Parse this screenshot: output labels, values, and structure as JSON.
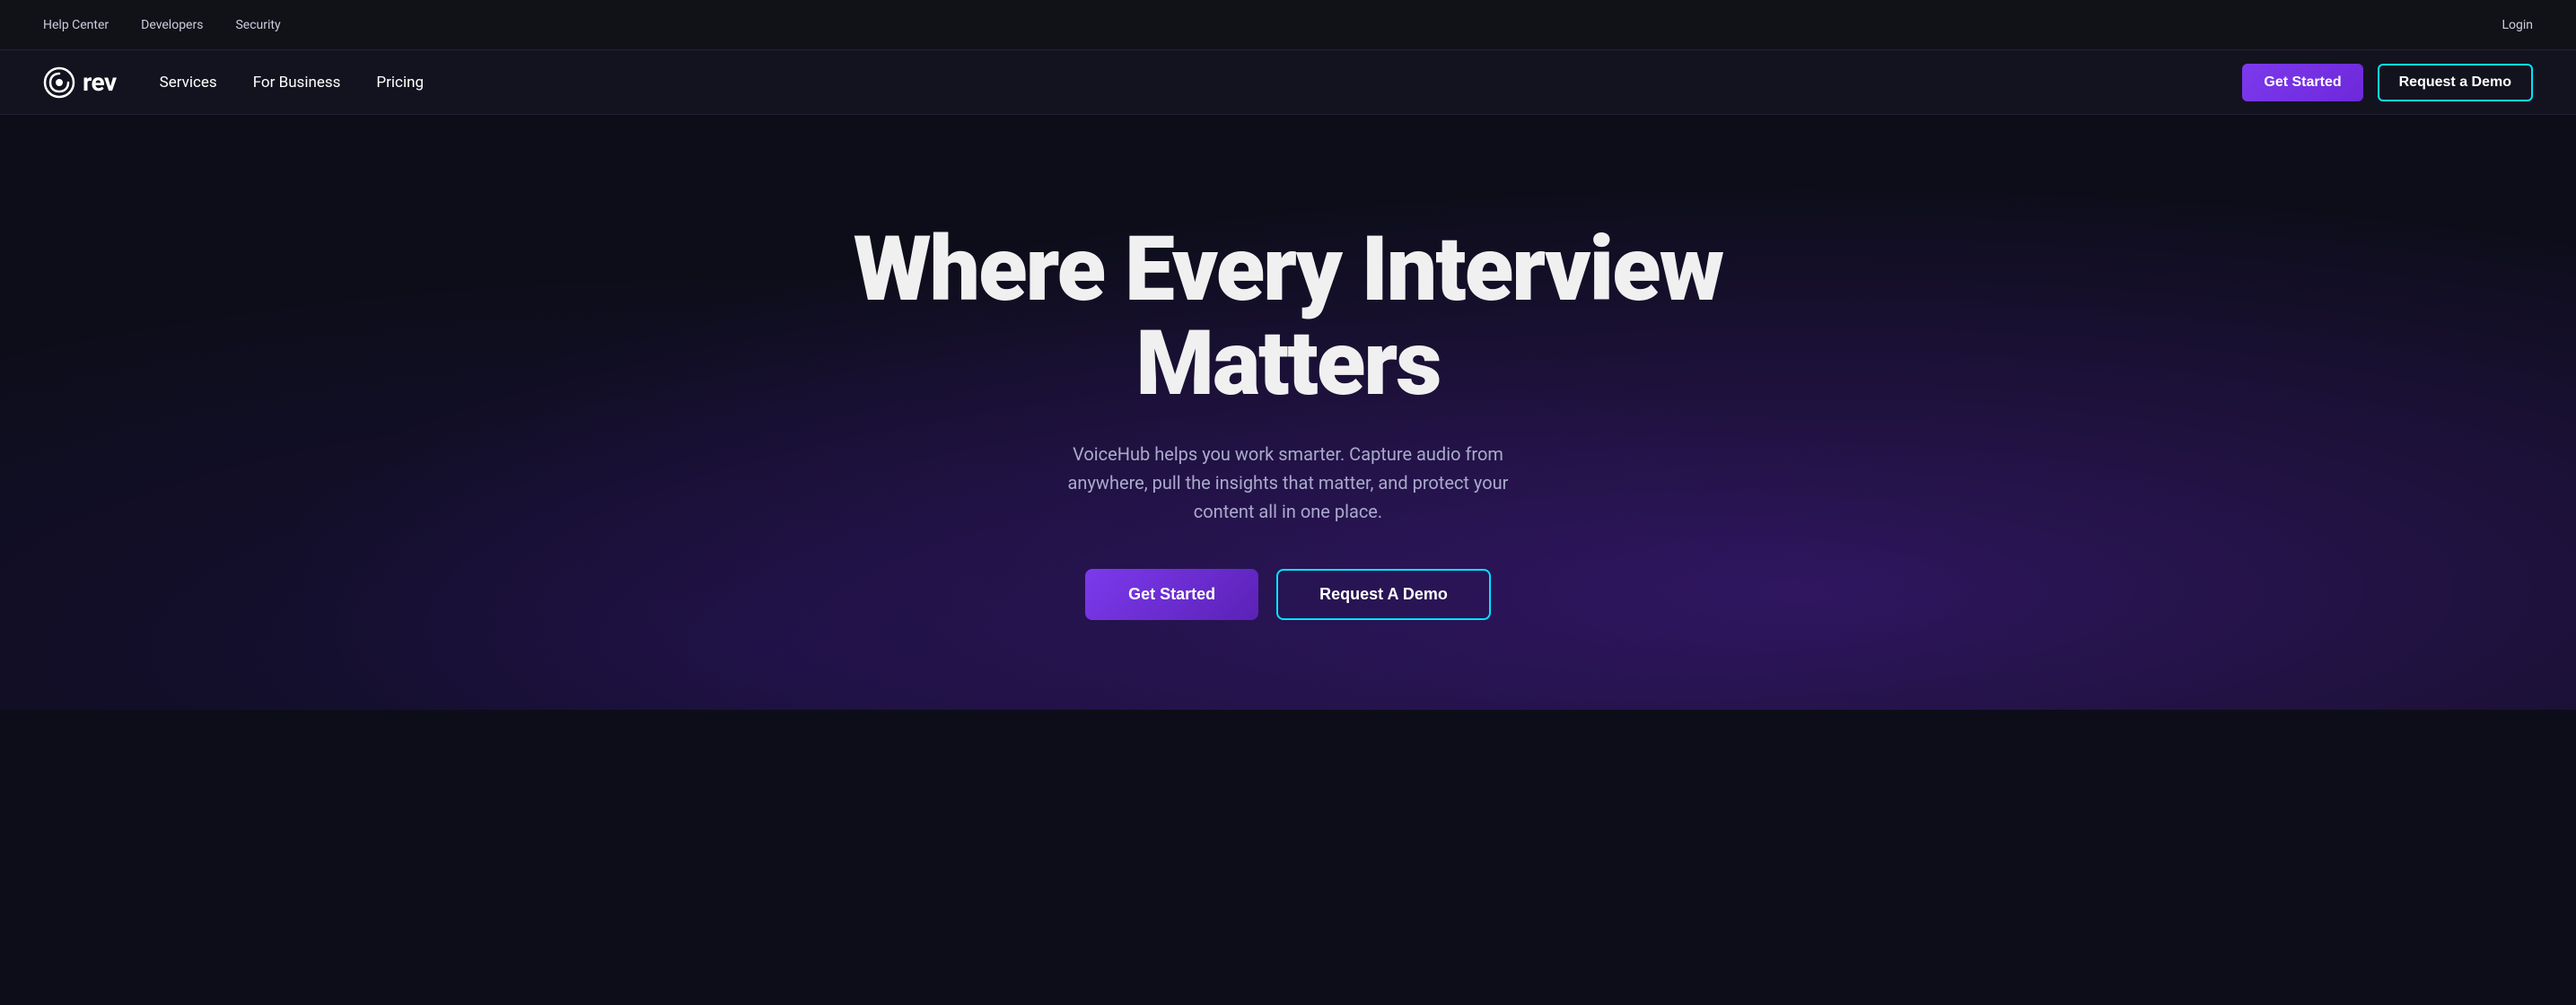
{
  "topbar": {
    "links": [
      {
        "label": "Help Center",
        "id": "help-center"
      },
      {
        "label": "Developers",
        "id": "developers"
      },
      {
        "label": "Security",
        "id": "security"
      }
    ],
    "login_label": "Login"
  },
  "mainnav": {
    "logo_text": "rev",
    "logo_icon_alt": "rev-logo",
    "links": [
      {
        "label": "Services",
        "id": "services"
      },
      {
        "label": "For Business",
        "id": "for-business"
      },
      {
        "label": "Pricing",
        "id": "pricing"
      }
    ],
    "get_started_label": "Get Started",
    "request_demo_label": "Request a Demo"
  },
  "hero": {
    "title": "Where Every Interview Matters",
    "subtitle": "VoiceHub helps you work smarter. Capture audio from anywhere, pull the insights that matter, and protect your content all in one place.",
    "get_started_label": "Get Started",
    "request_demo_label": "Request A Demo"
  },
  "colors": {
    "accent_purple": "#7c3aed",
    "accent_cyan": "#00e5ff"
  }
}
